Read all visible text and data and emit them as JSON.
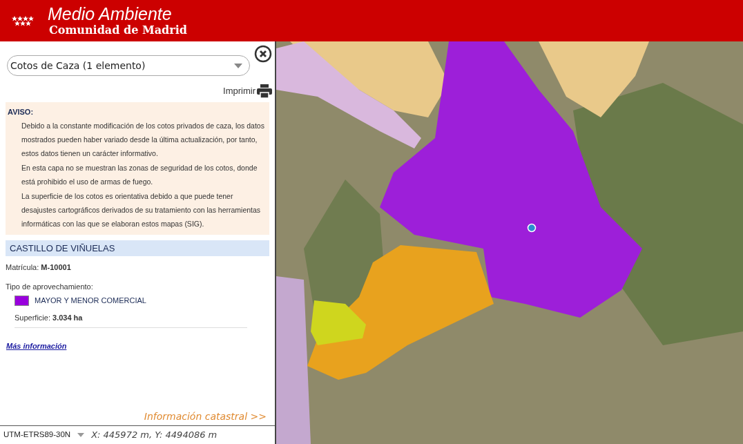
{
  "header": {
    "title": "Medio Ambiente",
    "subtitle": "Comunidad de Madrid"
  },
  "panel": {
    "layer_select": {
      "value": "Cotos de Caza (1 elemento)"
    },
    "print_label": "Imprimir",
    "notice": {
      "title": "AVISO:",
      "paragraphs": [
        "Debido a la constante modificación de los cotos privados de caza, los datos mostrados pueden haber variado desde la última actualización, por tanto, estos datos tienen un carácter informativo.",
        "En esta capa no se muestran las zonas de seguridad de los cotos, donde está prohibido el uso de armas de fuego.",
        "La superficie de los cotos es orientativa debido a que puede tener desajustes cartográficos derivados de su tratamiento con las herramientas informáticas con las que se elaboran estos mapas (SIG)."
      ]
    },
    "feature": {
      "name": "CASTILLO DE VIÑUELAS",
      "registration": "Matrícula: **M-10001**",
      "use_label": "Tipo de aprovechamiento:",
      "use": {
        "label": "MAYOR Y MENOR COMERCIAL",
        "color": "#9900dd"
      },
      "area": "Superficie: **3.034 ha**"
    },
    "more_link": "Más información",
    "cadastre_link": "Información catastral >>"
  },
  "coordinates": {
    "system": "UTM-ETRS89-30N",
    "position": "X: 445972 m, Y: 4494086 m"
  }
}
